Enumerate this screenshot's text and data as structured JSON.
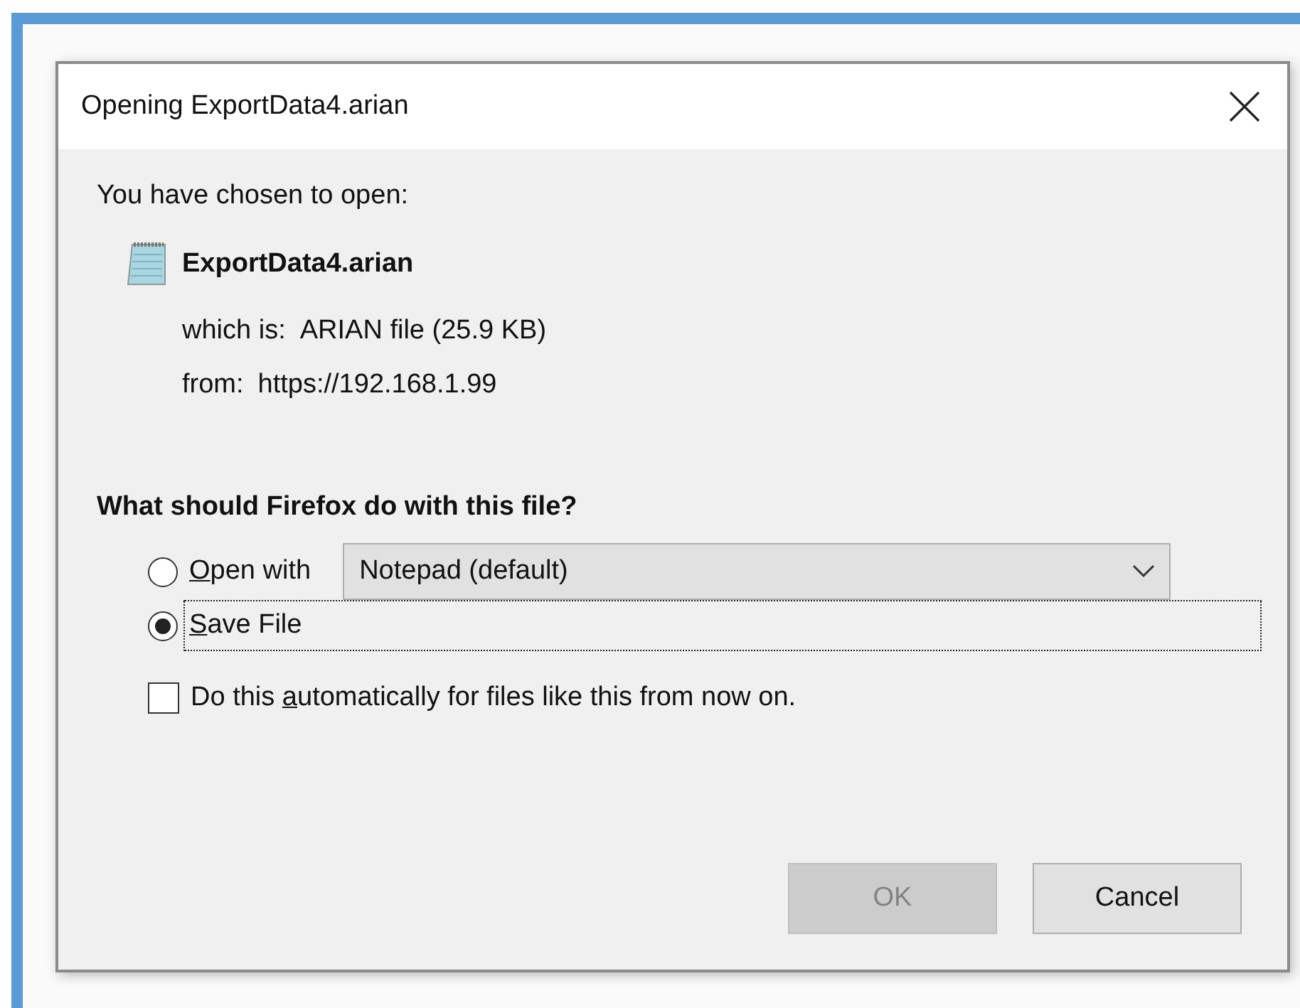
{
  "window": {
    "title": "Opening ExportData4.arian"
  },
  "intro": "You have chosen to open:",
  "file": {
    "name": "ExportData4.arian",
    "type_label": "which is:",
    "type_value": "ARIAN file (25.9 KB)",
    "from_label": "from:",
    "from_value": "https://192.168.1.99"
  },
  "question": "What should Firefox do with this file?",
  "options": [
    {
      "label": {
        "key": "O",
        "after": "pen with"
      },
      "selected": false,
      "focused": false,
      "app": "Notepad (default)"
    },
    {
      "label": {
        "key": "S",
        "after": "ave File"
      },
      "selected": true,
      "focused": true
    }
  ],
  "auto": {
    "label": {
      "before": "Do this ",
      "key": "a",
      "after": "utomatically for files like this from now on."
    },
    "checked": false
  },
  "buttons": [
    {
      "label": "OK",
      "disabled": true
    },
    {
      "label": "Cancel",
      "disabled": false
    }
  ]
}
